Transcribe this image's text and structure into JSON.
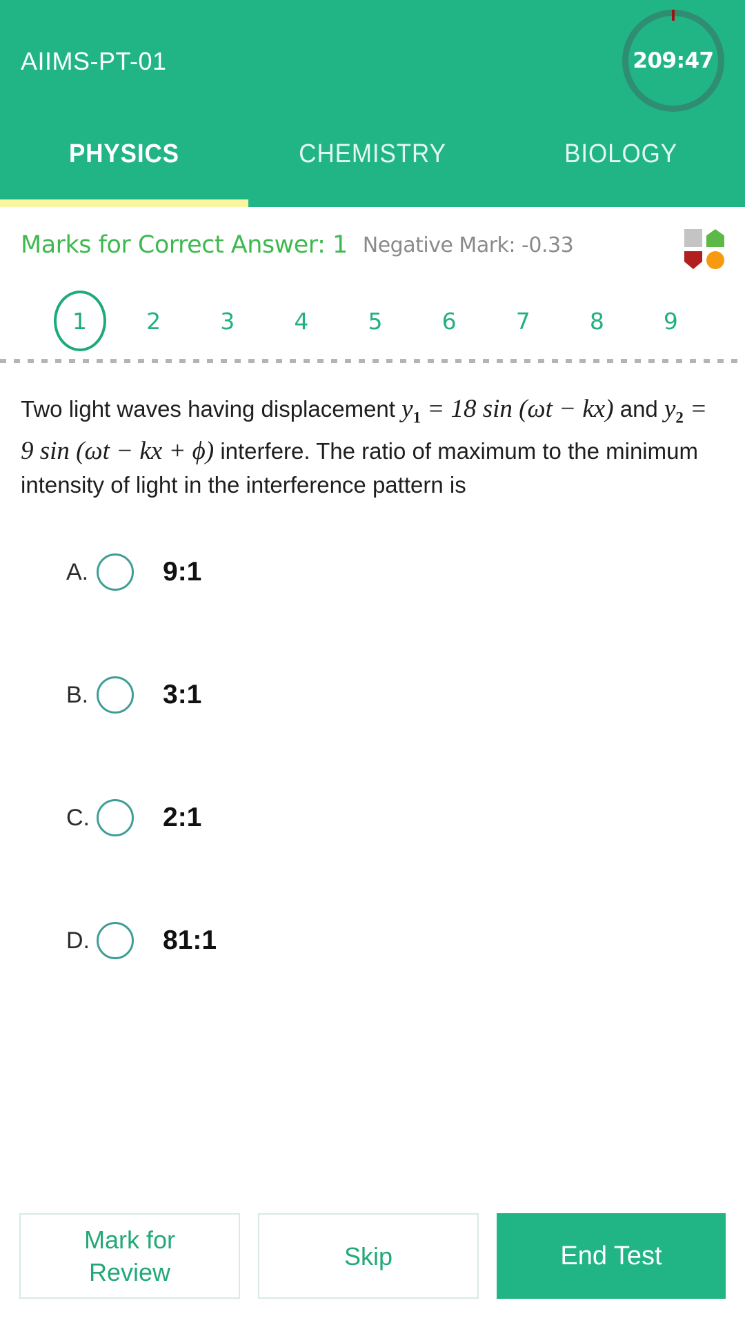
{
  "header": {
    "test_title": "AIIMS-PT-01",
    "timer": "209:47"
  },
  "tabs": [
    {
      "label": "PHYSICS",
      "active": true
    },
    {
      "label": "CHEMISTRY",
      "active": false
    },
    {
      "label": "BIOLOGY",
      "active": false
    }
  ],
  "marks": {
    "correct_text": "Marks for Correct Answer: 1",
    "negative_text": "Negative Mark: -0.33",
    "correct_color": "#3fb94f",
    "negative_color": "#8a8a8a"
  },
  "legend": {
    "not_visited_color": "#c4c4c4",
    "answered_color": "#5cb847",
    "marked_color": "#b11f1f",
    "review_color": "#f89a10"
  },
  "question_numbers": [
    "1",
    "2",
    "3",
    "4",
    "5",
    "6",
    "7",
    "8",
    "9"
  ],
  "current_question": "1",
  "question": {
    "part1": "Two light waves having displacement ",
    "eq1_y": "y",
    "eq1_sub": "1",
    "eq1_rest": "= 18 sin (ωt − kx)",
    "part2": " and ",
    "eq2_y": "y",
    "eq2_sub": "2",
    "eq2_rest": "= 9 sin (ωt − kx + ϕ)",
    "part3": " interfere. The ratio of maximum to the minimum intensity of light in the interference pattern is"
  },
  "options": [
    {
      "letter": "A.",
      "value": "9:1",
      "selected": false
    },
    {
      "letter": "B.",
      "value": "3:1",
      "selected": false
    },
    {
      "letter": "C.",
      "value": "2:1",
      "selected": false
    },
    {
      "letter": "D.",
      "value": "81:1",
      "selected": false
    }
  ],
  "footer": {
    "mark_for_review_line1": "Mark for",
    "mark_for_review_line2": "Review",
    "skip_label": "Skip",
    "end_test_label": "End Test"
  },
  "colors": {
    "brand_green": "#21b586",
    "ring_green": "#2f8d71",
    "tab_indicator_yellow": "#faf5a0",
    "radio_teal": "#3e9e95",
    "qnum_green": "#22b07e",
    "timer_tick_red": "#9b1414"
  }
}
